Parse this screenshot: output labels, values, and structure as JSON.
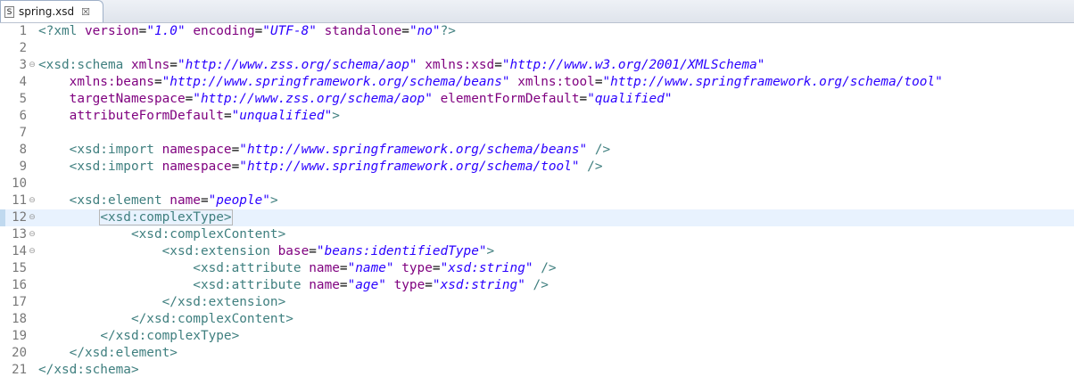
{
  "tab": {
    "title": "spring.xsd",
    "icon": "S"
  },
  "colors": {
    "tag": "#3f7f7f",
    "attribute": "#7f007f",
    "value": "#2a00ff",
    "current_line": "#e8f2fe"
  },
  "current_line": 12,
  "lines": [
    {
      "n": "1",
      "fold": "",
      "segs": [
        [
          "t",
          "<?xml "
        ],
        [
          "a",
          "version"
        ],
        [
          "p",
          "="
        ],
        [
          "v",
          "\"1.0\""
        ],
        [
          "p",
          " "
        ],
        [
          "a",
          "encoding"
        ],
        [
          "p",
          "="
        ],
        [
          "v",
          "\"UTF-8\""
        ],
        [
          "p",
          " "
        ],
        [
          "a",
          "standalone"
        ],
        [
          "p",
          "="
        ],
        [
          "v",
          "\"no\""
        ],
        [
          "t",
          "?>"
        ]
      ]
    },
    {
      "n": "2",
      "fold": "",
      "segs": []
    },
    {
      "n": "3",
      "fold": "⊖",
      "segs": [
        [
          "t",
          "<xsd:schema "
        ],
        [
          "a",
          "xmlns"
        ],
        [
          "p",
          "="
        ],
        [
          "v",
          "\"http://www.zss.org/schema/aop\""
        ],
        [
          "p",
          " "
        ],
        [
          "a",
          "xmlns:xsd"
        ],
        [
          "p",
          "="
        ],
        [
          "v",
          "\"http://www.w3.org/2001/XMLSchema\""
        ]
      ]
    },
    {
      "n": "4",
      "fold": "",
      "segs": [
        [
          "p",
          "    "
        ],
        [
          "a",
          "xmlns:beans"
        ],
        [
          "p",
          "="
        ],
        [
          "v",
          "\"http://www.springframework.org/schema/beans\""
        ],
        [
          "p",
          " "
        ],
        [
          "a",
          "xmlns:tool"
        ],
        [
          "p",
          "="
        ],
        [
          "v",
          "\"http://www.springframework.org/schema/tool\""
        ]
      ]
    },
    {
      "n": "5",
      "fold": "",
      "segs": [
        [
          "p",
          "    "
        ],
        [
          "a",
          "targetNamespace"
        ],
        [
          "p",
          "="
        ],
        [
          "v",
          "\"http://www.zss.org/schema/aop\""
        ],
        [
          "p",
          " "
        ],
        [
          "a",
          "elementFormDefault"
        ],
        [
          "p",
          "="
        ],
        [
          "v",
          "\"qualified\""
        ]
      ]
    },
    {
      "n": "6",
      "fold": "",
      "segs": [
        [
          "p",
          "    "
        ],
        [
          "a",
          "attributeFormDefault"
        ],
        [
          "p",
          "="
        ],
        [
          "v",
          "\"unqualified\""
        ],
        [
          "t",
          ">"
        ]
      ]
    },
    {
      "n": "7",
      "fold": "",
      "segs": []
    },
    {
      "n": "8",
      "fold": "",
      "segs": [
        [
          "p",
          "    "
        ],
        [
          "t",
          "<xsd:import "
        ],
        [
          "a",
          "namespace"
        ],
        [
          "p",
          "="
        ],
        [
          "v",
          "\"http://www.springframework.org/schema/beans\""
        ],
        [
          "p",
          " "
        ],
        [
          "t",
          "/>"
        ]
      ]
    },
    {
      "n": "9",
      "fold": "",
      "segs": [
        [
          "p",
          "    "
        ],
        [
          "t",
          "<xsd:import "
        ],
        [
          "a",
          "namespace"
        ],
        [
          "p",
          "="
        ],
        [
          "v",
          "\"http://www.springframework.org/schema/tool\""
        ],
        [
          "p",
          " "
        ],
        [
          "t",
          "/>"
        ]
      ]
    },
    {
      "n": "10",
      "fold": "",
      "segs": []
    },
    {
      "n": "11",
      "fold": "⊖",
      "segs": [
        [
          "p",
          "    "
        ],
        [
          "t",
          "<xsd:element "
        ],
        [
          "a",
          "name"
        ],
        [
          "p",
          "="
        ],
        [
          "v",
          "\"people\""
        ],
        [
          "t",
          ">"
        ]
      ]
    },
    {
      "n": "12",
      "fold": "⊖",
      "segs": [
        [
          "p",
          "        "
        ],
        [
          "t",
          "<xsd:complexType>"
        ]
      ]
    },
    {
      "n": "13",
      "fold": "⊖",
      "segs": [
        [
          "p",
          "            "
        ],
        [
          "t",
          "<xsd:complexContent>"
        ]
      ]
    },
    {
      "n": "14",
      "fold": "⊖",
      "segs": [
        [
          "p",
          "                "
        ],
        [
          "t",
          "<xsd:extension "
        ],
        [
          "a",
          "base"
        ],
        [
          "p",
          "="
        ],
        [
          "v",
          "\"beans:identifiedType\""
        ],
        [
          "t",
          ">"
        ]
      ]
    },
    {
      "n": "15",
      "fold": "",
      "segs": [
        [
          "p",
          "                    "
        ],
        [
          "t",
          "<xsd:attribute "
        ],
        [
          "a",
          "name"
        ],
        [
          "p",
          "="
        ],
        [
          "v",
          "\"name\""
        ],
        [
          "p",
          " "
        ],
        [
          "a",
          "type"
        ],
        [
          "p",
          "="
        ],
        [
          "v",
          "\"xsd:string\""
        ],
        [
          "p",
          " "
        ],
        [
          "t",
          "/>"
        ]
      ]
    },
    {
      "n": "16",
      "fold": "",
      "segs": [
        [
          "p",
          "                    "
        ],
        [
          "t",
          "<xsd:attribute "
        ],
        [
          "a",
          "name"
        ],
        [
          "p",
          "="
        ],
        [
          "v",
          "\"age\""
        ],
        [
          "p",
          " "
        ],
        [
          "a",
          "type"
        ],
        [
          "p",
          "="
        ],
        [
          "v",
          "\"xsd:string\""
        ],
        [
          "p",
          " "
        ],
        [
          "t",
          "/>"
        ]
      ]
    },
    {
      "n": "17",
      "fold": "",
      "segs": [
        [
          "p",
          "                "
        ],
        [
          "t",
          "</xsd:extension>"
        ]
      ]
    },
    {
      "n": "18",
      "fold": "",
      "segs": [
        [
          "p",
          "            "
        ],
        [
          "t",
          "</xsd:complexContent>"
        ]
      ]
    },
    {
      "n": "19",
      "fold": "",
      "segs": [
        [
          "p",
          "        "
        ],
        [
          "t",
          "</xsd:complexType>"
        ]
      ]
    },
    {
      "n": "20",
      "fold": "",
      "segs": [
        [
          "p",
          "    "
        ],
        [
          "t",
          "</xsd:element>"
        ]
      ]
    },
    {
      "n": "21",
      "fold": "",
      "segs": [
        [
          "t",
          "</xsd:schema>"
        ]
      ]
    }
  ]
}
